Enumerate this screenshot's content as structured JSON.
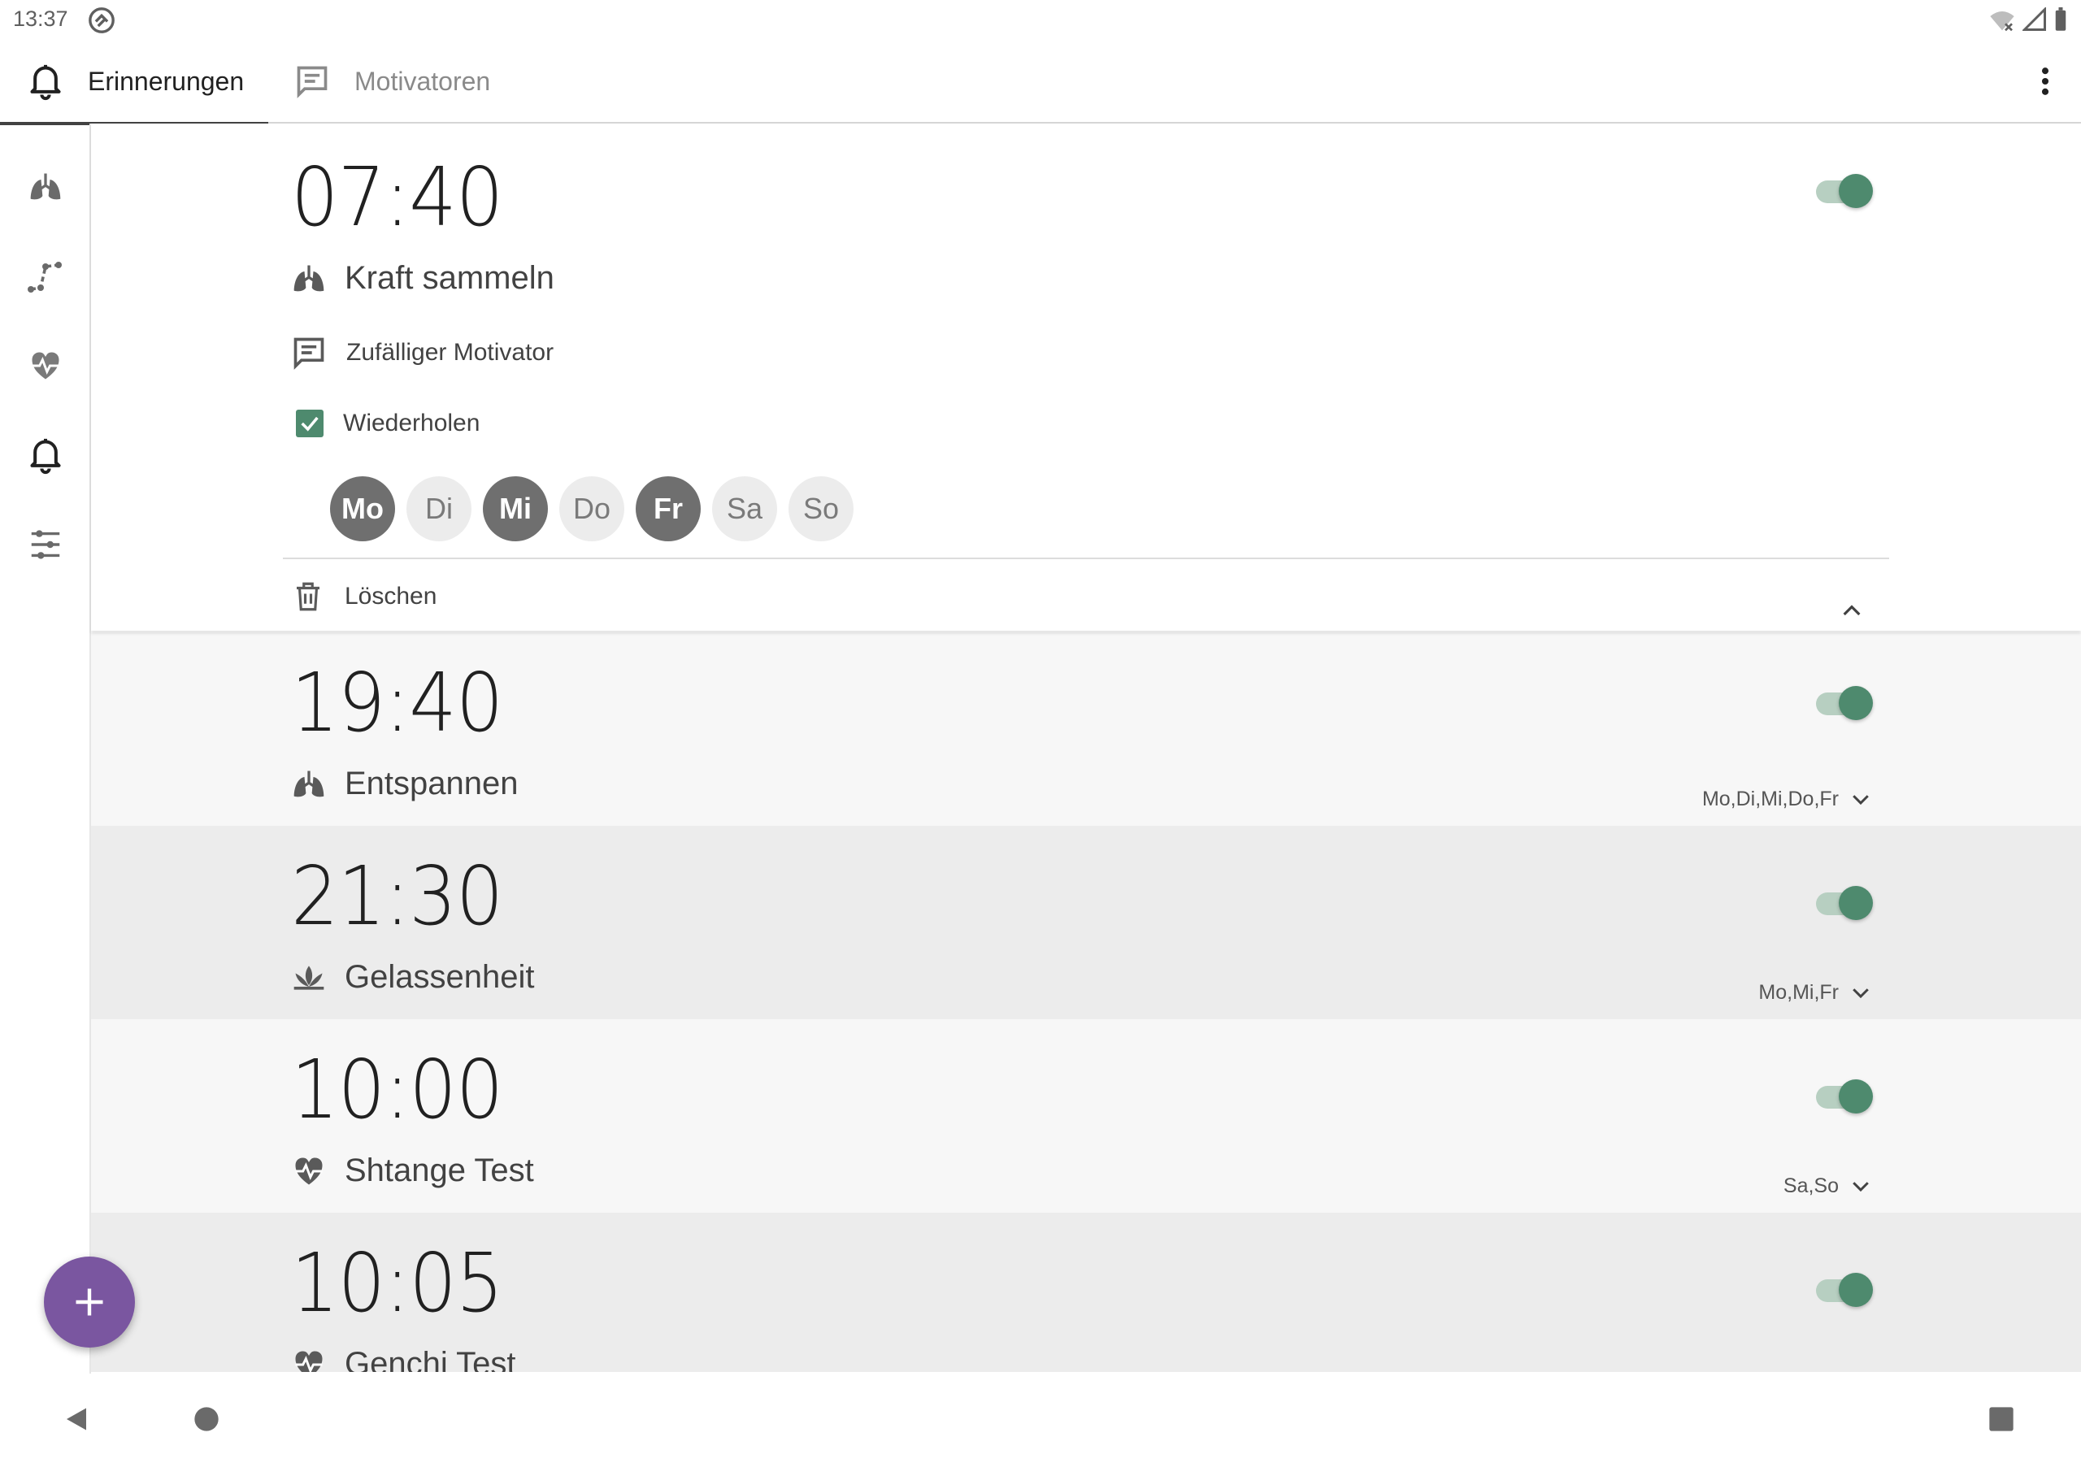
{
  "status_bar": {
    "time": "13:37"
  },
  "tabs": [
    {
      "label": "Erinnerungen",
      "icon": "bell-icon",
      "selected": true
    },
    {
      "label": "Motivatoren",
      "icon": "message-icon",
      "selected": false
    }
  ],
  "side_rail": [
    "lungs-icon",
    "progress-icon",
    "heart-icon",
    "bell-icon",
    "sliders-icon"
  ],
  "reminders": [
    {
      "time": "07:40",
      "exercise": "Kraft sammeln",
      "exercise_icon": "lungs-icon",
      "enabled": true,
      "expanded": true,
      "motivator": "Zufälliger Motivator",
      "repeat_label": "Wiederholen",
      "repeat": true,
      "days": [
        {
          "label": "Mo",
          "on": true
        },
        {
          "label": "Di",
          "on": false
        },
        {
          "label": "Mi",
          "on": true
        },
        {
          "label": "Do",
          "on": false
        },
        {
          "label": "Fr",
          "on": true
        },
        {
          "label": "Sa",
          "on": false
        },
        {
          "label": "So",
          "on": false
        }
      ],
      "delete_label": "Löschen"
    },
    {
      "time": "19:40",
      "exercise": "Entspannen",
      "exercise_icon": "lungs-icon",
      "enabled": true,
      "days_summary": "Mo,Di,Mi,Do,Fr"
    },
    {
      "time": "21:30",
      "exercise": "Gelassenheit",
      "exercise_icon": "lotus-icon",
      "enabled": true,
      "days_summary": "Mo,Mi,Fr"
    },
    {
      "time": "10:00",
      "exercise": "Shtange Test",
      "exercise_icon": "heart-icon",
      "enabled": true,
      "days_summary": "Sa,So"
    },
    {
      "time": "10:05",
      "exercise": "Genchi Test",
      "exercise_icon": "heart-icon",
      "enabled": true
    }
  ],
  "colors": {
    "accent": "#4e8a6e",
    "fab": "#7a56a0"
  }
}
